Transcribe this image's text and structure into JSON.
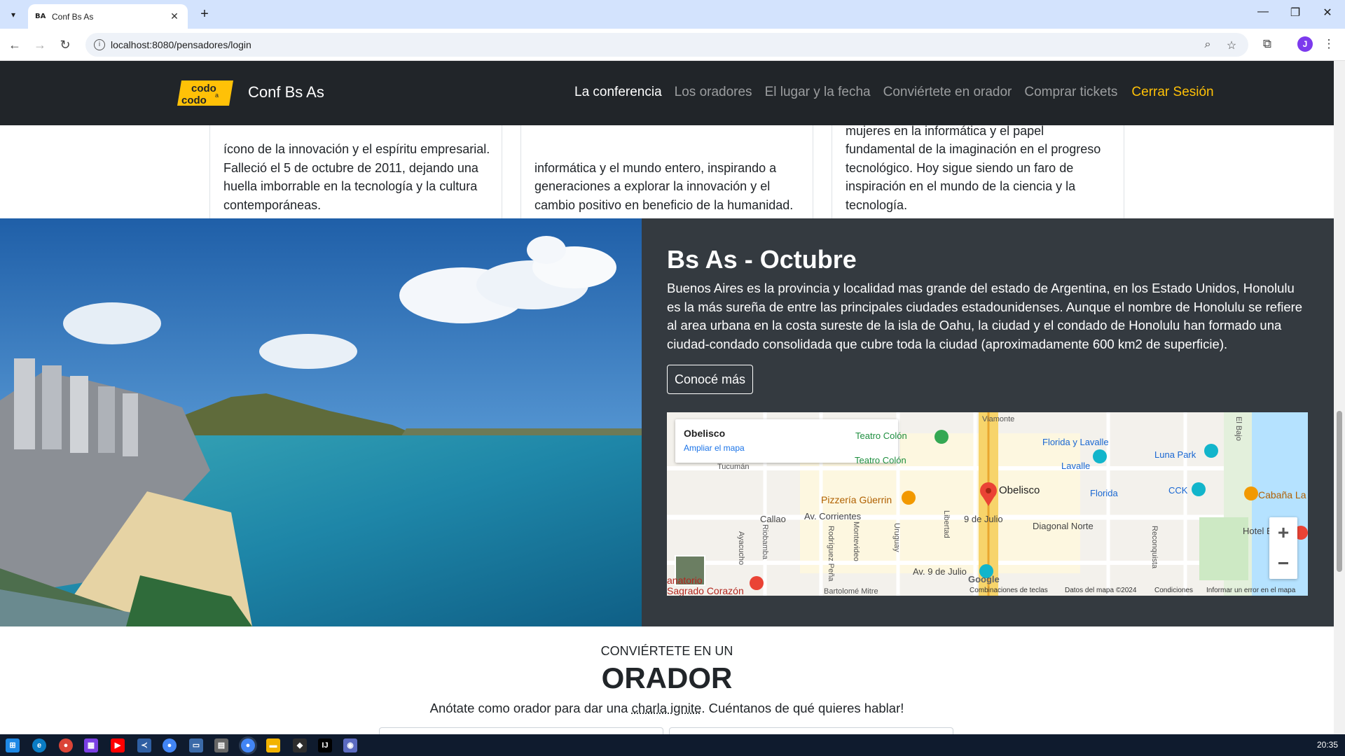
{
  "browser": {
    "tab_title": "Conf Bs As",
    "tab_favicon": "BA",
    "url": "localhost:8080/pensadores/login",
    "avatar_initial": "J"
  },
  "site": {
    "brand": "Conf Bs As",
    "logo_line1": "codo",
    "logo_line2": "codo",
    "nav": [
      {
        "label": "La conferencia"
      },
      {
        "label": "Los oradores"
      },
      {
        "label": "El lugar y la fecha"
      },
      {
        "label": "Conviértete en orador"
      },
      {
        "label": "Comprar tickets"
      },
      {
        "label": "Cerrar Sesión"
      }
    ]
  },
  "cards": [
    {
      "text": "ícono de la innovación y el espíritu empresarial. Falleció el 5 de octubre de 2011, dejando una huella imborrable en la tecnología y la cultura contemporáneas."
    },
    {
      "text": "informática y el mundo entero, inspirando a generaciones a explorar la innovación y el cambio positivo en beneficio de la humanidad."
    },
    {
      "text": "mujeres en la informática y el papel fundamental de la imaginación en el progreso tecnológico. Hoy sigue siendo un faro de inspiración en el mundo de la ciencia y la tecnología."
    }
  ],
  "location": {
    "title": "Bs As - Octubre",
    "description": "Buenos Aires es la provincia y localidad mas grande del estado de Argentina, en los Estado Unidos, Honolulu es la más sureña de entre las principales ciudades estadounidenses. Aunque el nombre de Honolulu se refiere al area urbana en la costa sureste de la isla de Oahu, la ciudad y el condado de Honolulu han formado una ciudad-condado consolidada que cubre toda la ciudad (aproximadamente 600 km2 de superficie).",
    "button": "Conocé más"
  },
  "map": {
    "place": "Obelisco",
    "expand_link": "Ampliar el mapa",
    "labels": {
      "teatro": "Teatro Colón",
      "florida_lavalle": "Florida y Lavalle",
      "luna_park": "Luna Park",
      "tucuman": "Tucumán",
      "colon_short": "Teatro Colón",
      "lavalle": "Lavalle",
      "guerrin": "Pizzería Güerrin",
      "obelisco": "Obelisco",
      "florida": "Florida",
      "cck": "CCK",
      "cabana": "Cabaña La",
      "callao": "Callao",
      "corrientes": "Av. Corrientes",
      "nueve_julio": "9 de Julio",
      "diagonal": "Diagonal Norte",
      "hotel": "Hotel Buenos",
      "av9": "Av. 9 de Julio",
      "sanatorio": "anatorio",
      "sagrado": "Sagrado Corazón",
      "viamonte": "Viamonte",
      "uruguay": "Uruguay",
      "libertad": "Libertad",
      "riobamba": "Riobamba",
      "ayacucho": "Ayacucho",
      "rodriguez": "Rodríguez Peña",
      "montevideo": "Montevideo",
      "reconquista": "Reconquista",
      "bartolome": "Bartolomé Mitre",
      "el_bajo": "El Bajo",
      "google": "Google"
    },
    "footer": {
      "shortcuts": "Combinaciones de teclas",
      "data": "Datos del mapa ©2024",
      "terms": "Condiciones",
      "report": "Informar un error en el mapa"
    },
    "zoom_in": "+",
    "zoom_out": "−"
  },
  "orador": {
    "kicker": "CONVIÉRTETE EN UN",
    "title": "ORADOR",
    "subtitle_pre": "Anótate como orador para dar una ",
    "subtitle_abbr": "charla ignite",
    "subtitle_post": ". Cuéntanos de qué quieres hablar!"
  },
  "taskbar": {
    "clock": "20:35"
  }
}
